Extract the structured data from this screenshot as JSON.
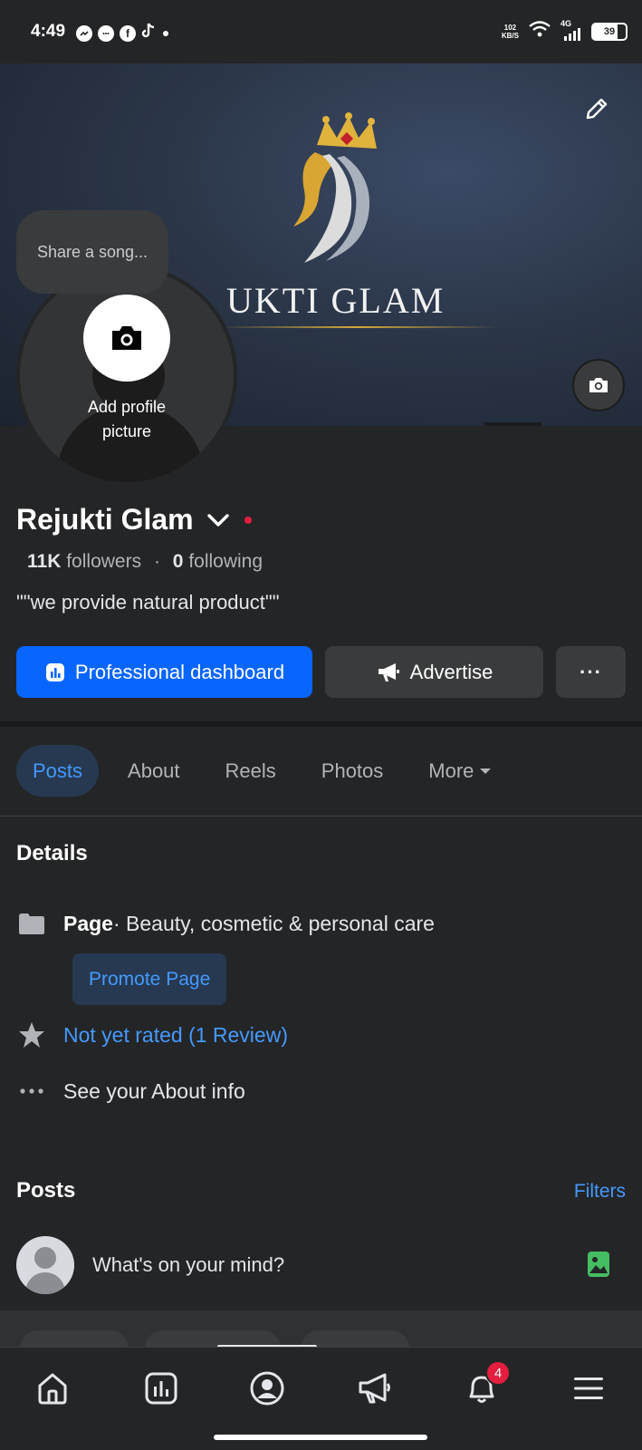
{
  "status_bar": {
    "time": "4:49",
    "app_icons": [
      "messenger-icon",
      "chat-icon",
      "facebook-icon",
      "tiktok-icon"
    ],
    "speed_value": "102",
    "speed_unit": "KB/S",
    "network": "4G",
    "battery": "39"
  },
  "cover": {
    "title": "REJUKTI GLAM",
    "title_visible": "UKTI GLAM"
  },
  "profile_picture": {
    "song_prompt": "Share a song...",
    "add_label": "Add profile picture"
  },
  "page": {
    "name": "Rejukti Glam",
    "followers_count": "11K",
    "followers_label": "followers",
    "following_count": "0",
    "following_label": "following",
    "bio": "\"\"we provide natural product\"\""
  },
  "actions": {
    "dashboard_label": "Professional dashboard",
    "advertise_label": "Advertise",
    "more_label": "···"
  },
  "tabs": [
    {
      "label": "Posts",
      "active": true
    },
    {
      "label": "About",
      "active": false
    },
    {
      "label": "Reels",
      "active": false
    },
    {
      "label": "Photos",
      "active": false
    },
    {
      "label": "More",
      "active": false
    }
  ],
  "details": {
    "title": "Details",
    "page_type_label": "Page",
    "category": " · Beauty, cosmetic & personal care",
    "promote_label": "Promote Page",
    "rating_text": "Not yet rated (1 Review)",
    "about_text": "See your About info"
  },
  "posts": {
    "title": "Posts",
    "filters_label": "Filters",
    "composer_placeholder": "What's on your mind?"
  },
  "bottom_nav": {
    "items": [
      "home-icon",
      "dashboard-icon",
      "profile-icon",
      "megaphone-icon",
      "bell-icon",
      "menu-icon"
    ],
    "notifications_badge": "4"
  },
  "colors": {
    "primary": "#0866ff",
    "link": "#4599ff",
    "background": "#242526",
    "surface": "#3a3b3c",
    "badge": "#e41e3f",
    "gold": "#d4a93a"
  }
}
